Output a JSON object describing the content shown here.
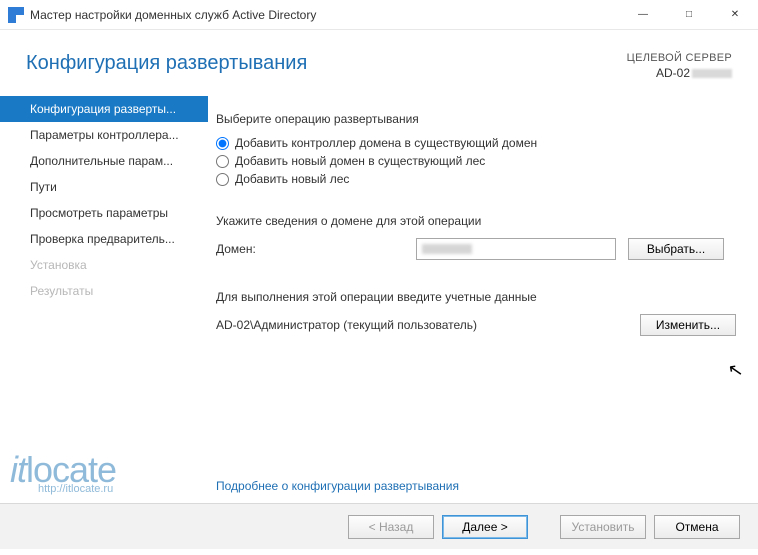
{
  "window": {
    "title": "Мастер настройки доменных служб Active Directory"
  },
  "header": {
    "title": "Конфигурация развертывания",
    "target_label": "ЦЕЛЕВОЙ СЕРВЕР",
    "target_server": "AD-02"
  },
  "sidebar": {
    "items": [
      {
        "label": "Конфигурация разверты...",
        "state": "active"
      },
      {
        "label": "Параметры контроллера...",
        "state": "normal"
      },
      {
        "label": "Дополнительные парам...",
        "state": "normal"
      },
      {
        "label": "Пути",
        "state": "normal"
      },
      {
        "label": "Просмотреть параметры",
        "state": "normal"
      },
      {
        "label": "Проверка предваритель...",
        "state": "normal"
      },
      {
        "label": "Установка",
        "state": "disabled"
      },
      {
        "label": "Результаты",
        "state": "disabled"
      }
    ]
  },
  "content": {
    "operation_label": "Выберите операцию развертывания",
    "radios": [
      {
        "label": "Добавить контроллер домена в существующий домен",
        "checked": true
      },
      {
        "label": "Добавить новый домен в существующий лес",
        "checked": false
      },
      {
        "label": "Добавить новый лес",
        "checked": false
      }
    ],
    "domain_section_label": "Укажите сведения о домене для этой операции",
    "domain_field_label": "Домен:",
    "domain_value": "",
    "select_button": "Выбрать...",
    "creds_label": "Для выполнения этой операции введите учетные данные",
    "account": "AD-02\\Администратор (текущий пользователь)",
    "change_button": "Изменить...",
    "more_link": "Подробнее о конфигурации развертывания"
  },
  "footer": {
    "back": "< Назад",
    "next": "Далее >",
    "install": "Установить",
    "cancel": "Отмена"
  },
  "watermark": {
    "brand": "itlocate",
    "url": "http://itlocate.ru"
  }
}
